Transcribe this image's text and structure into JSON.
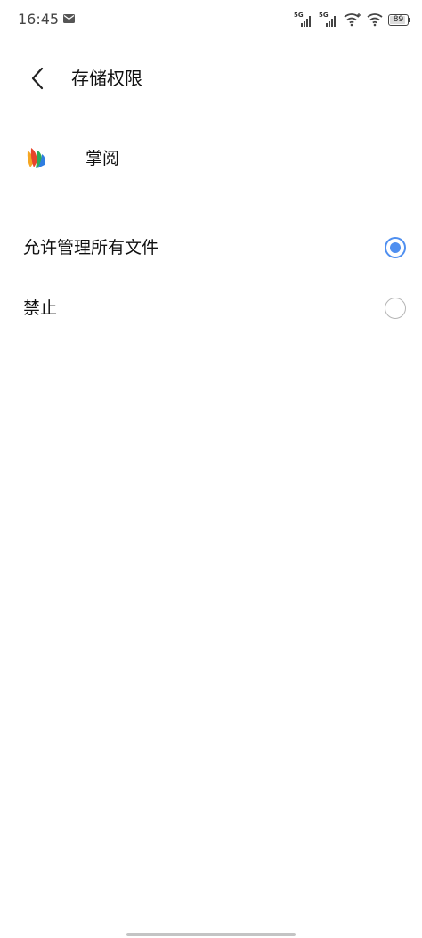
{
  "status_bar": {
    "time": "16:45",
    "network_1": "5G",
    "network_2": "5G",
    "battery": "89",
    "battery_level": 0.89,
    "icons": [
      "mail-icon",
      "signal-icon",
      "wifi-icon",
      "battery-icon"
    ]
  },
  "header": {
    "title": "存储权限",
    "back_icon": "chevron-left-icon"
  },
  "app": {
    "name": "掌阅",
    "icon": "zhangyue-app-icon"
  },
  "options": [
    {
      "label": "允许管理所有文件",
      "selected": true
    },
    {
      "label": "禁止",
      "selected": false
    }
  ],
  "colors": {
    "accent": "#4f8ff0",
    "radio_off": "#b5b5b5",
    "text": "#111111"
  }
}
